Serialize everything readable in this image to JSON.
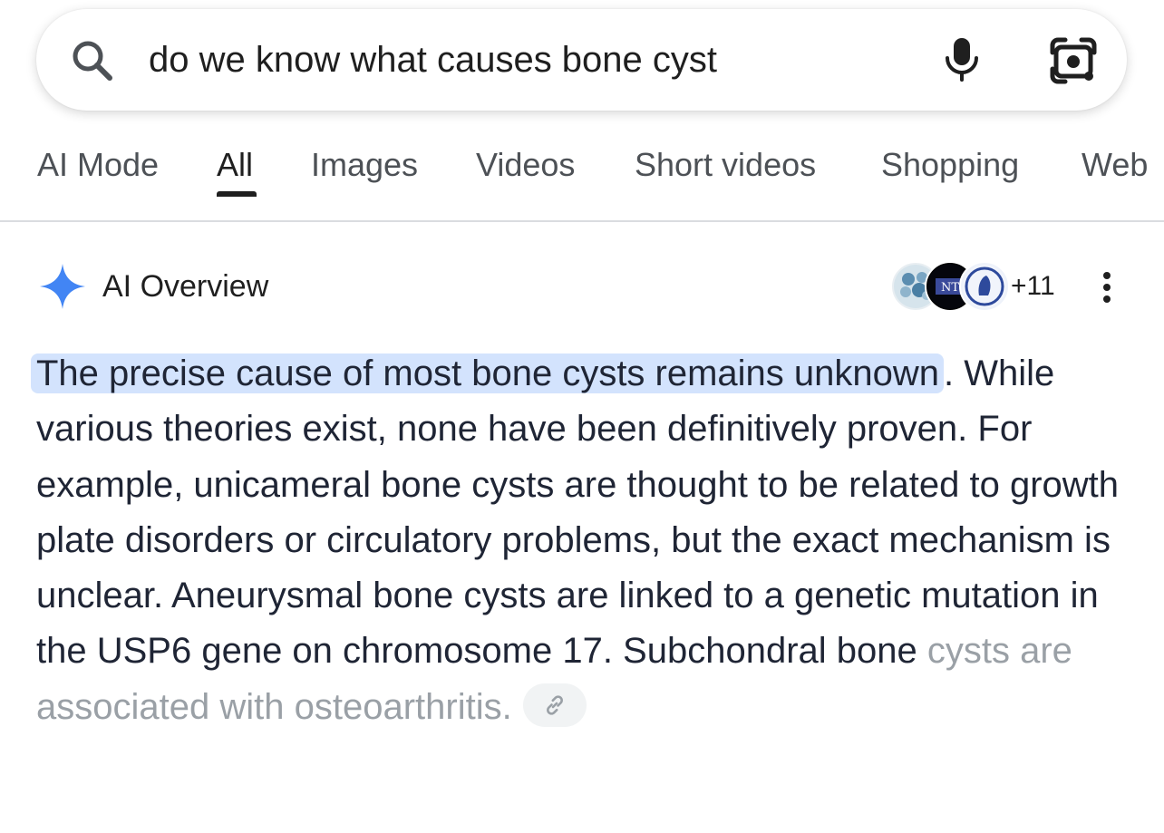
{
  "search": {
    "query": "do we know what causes bone cyst"
  },
  "tabs": [
    {
      "label": "AI Mode",
      "active": false
    },
    {
      "label": "All",
      "active": true
    },
    {
      "label": "Images",
      "active": false
    },
    {
      "label": "Videos",
      "active": false
    },
    {
      "label": "Short videos",
      "active": false
    },
    {
      "label": "Shopping",
      "active": false
    },
    {
      "label": "Web",
      "active": false
    }
  ],
  "ai_overview": {
    "title": "AI Overview",
    "sources_more": "+11",
    "source_badge_text": "NT",
    "highlighted": "The precise cause of most bone cysts remains unknown",
    "after_highlight": ".",
    "body": " While various theories exist, none have been definitively proven. For example, unicameral bone cysts are thought to be related to growth plate disorders or circulatory problems, but the exact mechanism is unclear. Aneurysmal bone cysts are linked to a genetic mutation in the USP6 gene on chromosome 17. Subchondral bone ",
    "faded_tail": "cysts are associated with osteoarthritis."
  },
  "colors": {
    "accent_blue": "#4285f4",
    "highlight": "#d3e3fd",
    "body_text": "#1f2535",
    "muted": "#4d5156"
  }
}
